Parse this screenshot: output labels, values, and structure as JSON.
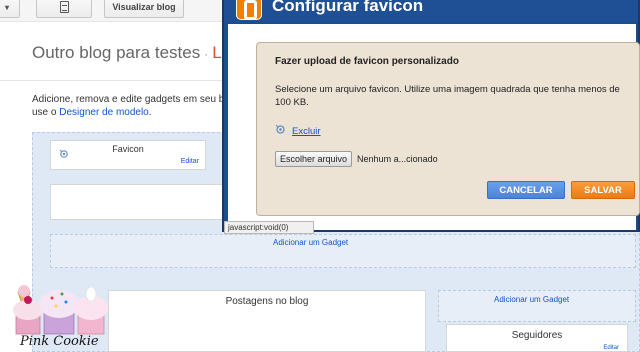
{
  "toolbar": {
    "view_blog_label": "Visualizar blog"
  },
  "header": {
    "blog_title": "Outro blog para testes",
    "separator": "·",
    "crumb": "La"
  },
  "intro": {
    "text": "Adicione, remova e edite gadgets em seu b",
    "text2": "use o ",
    "link": "Designer de modelo",
    "suffix": "."
  },
  "widgets": {
    "favicon_title": "Favicon",
    "favicon_edit": "Editar",
    "add_gadget": "Adicionar um Gadget",
    "add_gadget_sidebar": "Adicionar um Gadget",
    "posts_title": "Postagens no blog",
    "followers_title": "Seguidores",
    "followers_edit": "Editar"
  },
  "status_bar": "javascript:void(0)",
  "dialog": {
    "title": "Configurar favicon",
    "heading": "Fazer upload de favicon personalizado",
    "description": "Selecione um arquivo favicon. Utilize uma imagem quadrada que tenha menos de 100 KB.",
    "delete_label": "Excluir",
    "file_button": "Escolher arquivo",
    "file_name": "Nenhum a...cionado",
    "cancel_label": "CANCELAR",
    "save_label": "SALVAR"
  },
  "watermark": {
    "text": "Pink Cookie"
  },
  "colors": {
    "dialog_frame": "#1e4d8c",
    "panel_bg": "#ece3d5",
    "cancel_button": "#4b83d9",
    "save_button": "#f07a12",
    "link": "#1155cc",
    "canvas_bg": "#dfe9f5"
  },
  "icons": {
    "favicon": "favicon-icon",
    "delete_favicon": "favicon-icon",
    "blogger": "blogger-logo-icon"
  }
}
